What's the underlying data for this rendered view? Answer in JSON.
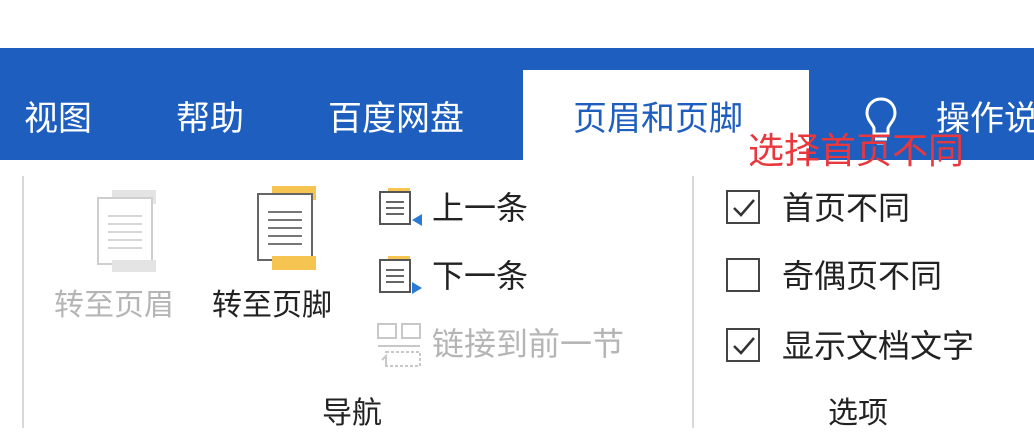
{
  "tabs": [
    {
      "label": "视图"
    },
    {
      "label": "帮助"
    },
    {
      "label": "百度网盘"
    },
    {
      "label": "页眉和页脚",
      "active": true
    },
    {
      "label": "操作说"
    }
  ],
  "annotation": "选择首页不同",
  "navigation": {
    "goto_header": "转至页眉",
    "goto_footer": "转至页脚",
    "previous": "上一条",
    "next": "下一条",
    "link_previous": "链接到前一节",
    "group_label": "导航"
  },
  "options": {
    "different_first_page": {
      "label": "首页不同",
      "checked": true
    },
    "different_odd_even": {
      "label": "奇偶页不同",
      "checked": false
    },
    "show_document_text": {
      "label": "显示文档文字",
      "checked": true
    },
    "group_label": "选项"
  },
  "colors": {
    "ribbon_blue": "#1e5ebf",
    "annotation_red": "#e8383d",
    "disabled_gray": "#b5b5b5",
    "accent_yellow": "#f5c451",
    "accent_blue": "#2b7bd6"
  }
}
